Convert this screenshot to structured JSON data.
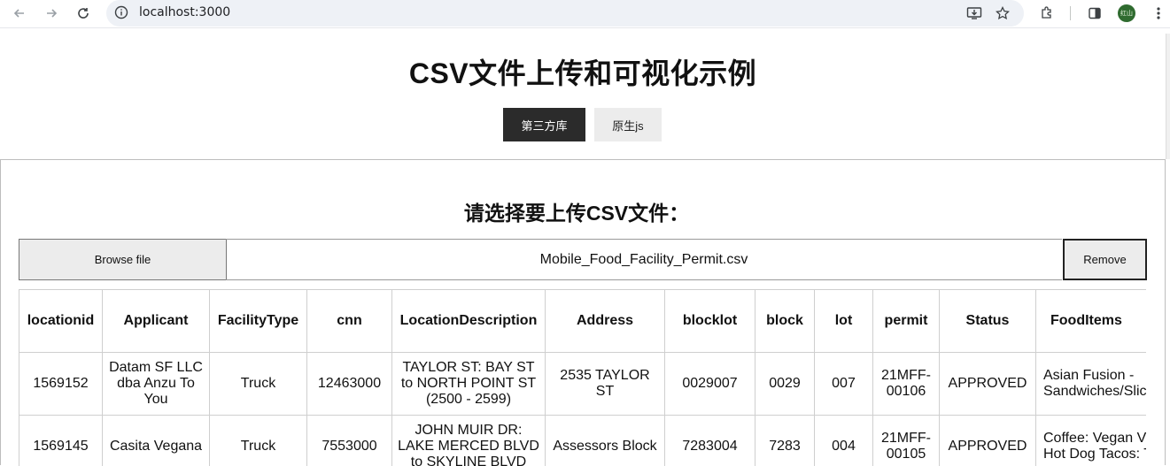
{
  "browser": {
    "url": "localhost:3000",
    "avatar_text": "红山"
  },
  "page": {
    "title": "CSV文件上传和可视化示例",
    "tabs": [
      {
        "label": "第三方库",
        "active": true
      },
      {
        "label": "原生js",
        "active": false
      }
    ]
  },
  "upload": {
    "title": "请选择要上传CSV文件：",
    "browse_label": "Browse file",
    "file_name": "Mobile_Food_Facility_Permit.csv",
    "remove_label": "Remove"
  },
  "table": {
    "columns": [
      "locationid",
      "Applicant",
      "FacilityType",
      "cnn",
      "LocationDescription",
      "Address",
      "blocklot",
      "block",
      "lot",
      "permit",
      "Status",
      "FoodItems"
    ],
    "rows": [
      [
        "1569152",
        "Datam SF LLC dba Anzu To You",
        "Truck",
        "12463000",
        "TAYLOR ST: BAY ST to NORTH POINT ST (2500 - 2599)",
        "2535 TAYLOR ST",
        "0029007",
        "0029",
        "007",
        "21MFF-00106",
        "APPROVED",
        "Asian Fusion - Sandwiches/Slic"
      ],
      [
        "1569145",
        "Casita Vegana",
        "Truck",
        "7553000",
        "JOHN MUIR DR: LAKE MERCED BLVD to SKYLINE BLVD",
        "Assessors Block",
        "7283004",
        "7283",
        "004",
        "21MFF-00105",
        "APPROVED",
        "Coffee: Vegan Vegan Hot Dog Tacos: Tor"
      ]
    ]
  }
}
